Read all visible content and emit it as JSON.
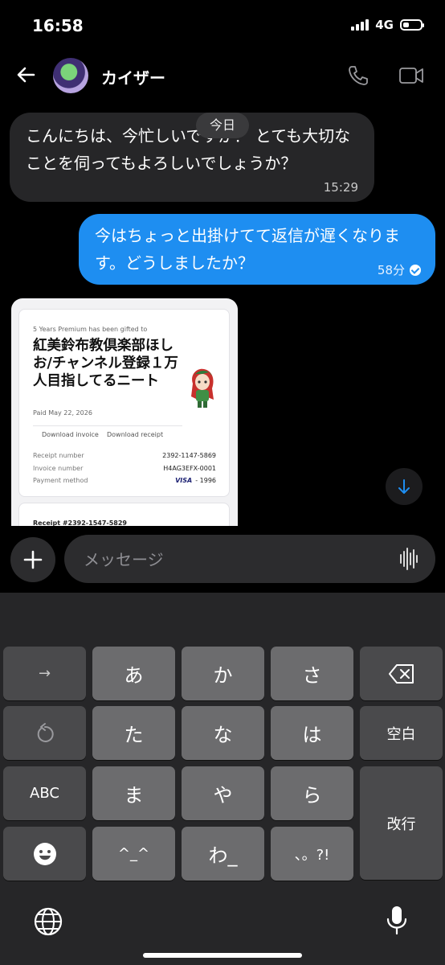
{
  "status_bar": {
    "time": "16:58",
    "network": "4G",
    "battery_level": 0.35
  },
  "header": {
    "contact_name": "カイザー"
  },
  "date_chip": "今日",
  "messages": [
    {
      "direction": "in",
      "text": "こんにちは、今忙しいですか？ とても大切なことを伺ってもよろしいでしょうか？",
      "time": "15:29"
    },
    {
      "direction": "out",
      "text": "今はちょっと出掛けてて返信が遅くなります。どうしましたか？",
      "time": "58分",
      "status": "read"
    }
  ],
  "receipt": {
    "gifted_line": "5 Years Premium has been gifted to",
    "title": "紅美鈴布教倶楽部ほしお/チャンネル登録１万人目指してるニート",
    "paid": "Paid May 22, 2026",
    "download_invoice": "Download invoice",
    "download_receipt": "Download receipt",
    "rows": [
      {
        "label": "Receipt number",
        "value": "2392-1147-5869"
      },
      {
        "label": "Invoice number",
        "value": "H4AG3EFX-0001"
      },
      {
        "label": "Payment method",
        "brand": "VISA",
        "value": "- 1996"
      }
    ],
    "second_receipt": "Receipt #2392-1547-5829"
  },
  "composer": {
    "placeholder": "メッセージ"
  },
  "keyboard": {
    "row1": [
      "→",
      "あ",
      "か",
      "さ"
    ],
    "row2": [
      "た",
      "な",
      "は"
    ],
    "row3": [
      "ABC",
      "ま",
      "や",
      "ら"
    ],
    "row4": [
      "^_^",
      "わ_",
      "、。?!"
    ],
    "space": "空白",
    "enter": "改行"
  },
  "colors": {
    "outgoing_bubble": "#1e8ef1",
    "incoming_bubble": "#262628",
    "keyboard_bg": "#262628"
  }
}
